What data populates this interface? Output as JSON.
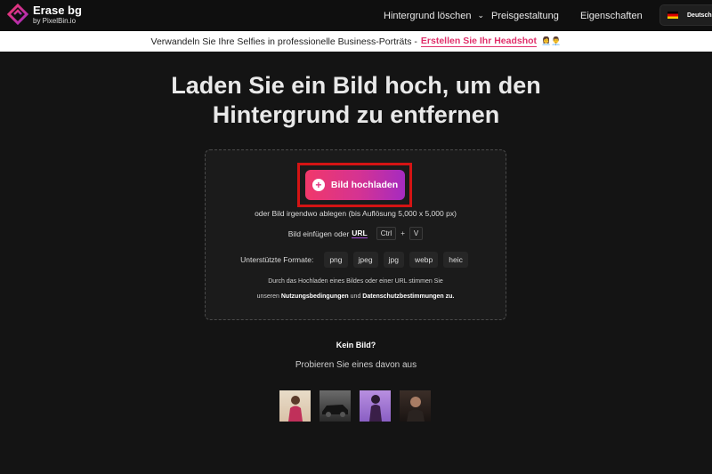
{
  "header": {
    "logo_title": "Erase bg",
    "logo_subtitle": "by PixelBin.io",
    "nav": [
      {
        "label": "Hintergrund löschen"
      },
      {
        "label": "Preisgestaltung"
      },
      {
        "label": "Eigenschaften"
      }
    ],
    "language": "Deutsch"
  },
  "banner": {
    "text": "Verwandeln Sie Ihre Selfies in professionelle Business-Porträts -",
    "link": "Erstellen Sie Ihr Headshot",
    "emoji": "👩‍💼👨‍💼"
  },
  "hero": {
    "headline_line1": "Laden Sie ein Bild hoch, um den",
    "headline_line2": "Hintergrund zu entfernen"
  },
  "upload": {
    "button_label": "Bild hochladen",
    "drop_text": "oder Bild irgendwo ablegen (bis Auflösung 5,000 x 5,000 px)",
    "paste_text": "Bild einfügen oder",
    "url_label": "URL",
    "key_ctrl": "Ctrl",
    "key_plus": "+",
    "key_v": "V",
    "formats_label": "Unterstützte Formate:",
    "formats": [
      "png",
      "jpeg",
      "jpg",
      "webp",
      "heic"
    ],
    "legal_line1": "Durch das Hochladen eines Bildes oder einer URL stimmen Sie",
    "legal_line2_pre": "unseren",
    "legal_terms": "Nutzungsbedingungen",
    "legal_and": "und",
    "legal_privacy": "Datenschutzbestimmungen zu."
  },
  "samples": {
    "heading": "Kein Bild?",
    "subheading": "Probieren Sie eines davon aus"
  },
  "colors": {
    "background": "#141414",
    "accent_start": "#f1386a",
    "accent_end": "#a52bc1",
    "highlight": "#d41414"
  }
}
